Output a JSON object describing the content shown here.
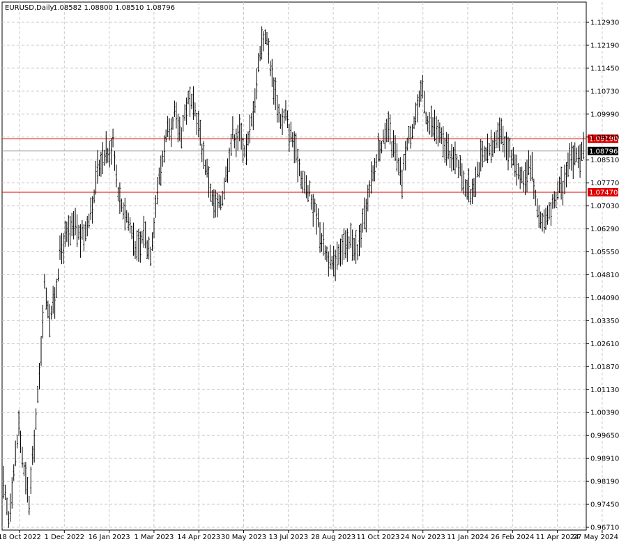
{
  "header": {
    "symbol": "EURUSD,Daily",
    "ohlc": "1.08582 1.08800 1.08510 1.08796"
  },
  "chart_data": {
    "type": "ohlc-bar",
    "title": "EURUSD,Daily",
    "ylim": [
      0.9667,
      1.133
    ],
    "y_ticks": [
      "1.12930",
      "1.12190",
      "1.11450",
      "1.10730",
      "1.09990",
      "1.09250",
      "1.08510",
      "1.07770",
      "1.07030",
      "1.06290",
      "1.05550",
      "1.04810",
      "1.04090",
      "1.03350",
      "1.02610",
      "1.01870",
      "1.01130",
      "1.00390",
      "0.99650",
      "0.98910",
      "0.98190",
      "0.97450",
      "0.96710"
    ],
    "x_ticks": [
      "18 Oct 2022",
      "1 Dec 2022",
      "16 Jan 2023",
      "1 Mar 2023",
      "14 Apr 2023",
      "30 May 2023",
      "13 Jul 2023",
      "28 Aug 2023",
      "11 Oct 2023",
      "24 Nov 2023",
      "11 Jan 2024",
      "26 Feb 2024",
      "11 Apr 2024",
      "27 May 2024"
    ],
    "horizontal_lines": [
      {
        "label": "1.09190",
        "value": 1.0919,
        "color": "#dd0000"
      },
      {
        "label": "1.07470",
        "value": 1.0747,
        "color": "#dd0000"
      },
      {
        "label": "1.08796",
        "value": 1.08796,
        "color": "#999999",
        "current": true
      }
    ],
    "path_points": [
      [
        0,
        0.98
      ],
      [
        3,
        0.97
      ],
      [
        6,
        0.985
      ],
      [
        9,
        1.0
      ],
      [
        12,
        0.985
      ],
      [
        15,
        0.975
      ],
      [
        18,
        0.995
      ],
      [
        21,
        1.015
      ],
      [
        24,
        1.045
      ],
      [
        27,
        1.035
      ],
      [
        30,
        1.04
      ],
      [
        33,
        1.055
      ],
      [
        36,
        1.06
      ],
      [
        39,
        1.062
      ],
      [
        42,
        1.064
      ],
      [
        45,
        1.06
      ],
      [
        48,
        1.062
      ],
      [
        51,
        1.07
      ],
      [
        53,
        1.072
      ],
      [
        54,
        1.08
      ],
      [
        57,
        1.085
      ],
      [
        60,
        1.089
      ],
      [
        62,
        1.086
      ],
      [
        64,
        1.093
      ],
      [
        66,
        1.08
      ],
      [
        68,
        1.072
      ],
      [
        70,
        1.07
      ],
      [
        72,
        1.067
      ],
      [
        74,
        1.064
      ],
      [
        76,
        1.06
      ],
      [
        78,
        1.056
      ],
      [
        80,
        1.057
      ],
      [
        82,
        1.063
      ],
      [
        84,
        1.058
      ],
      [
        86,
        1.056
      ],
      [
        88,
        1.065
      ],
      [
        90,
        1.076
      ],
      [
        92,
        1.082
      ],
      [
        94,
        1.09
      ],
      [
        96,
        1.094
      ],
      [
        98,
        1.092
      ],
      [
        100,
        1.1
      ],
      [
        102,
        1.096
      ],
      [
        104,
        1.094
      ],
      [
        106,
        1.1
      ],
      [
        108,
        1.104
      ],
      [
        110,
        1.102
      ],
      [
        112,
        1.101
      ],
      [
        114,
        1.096
      ],
      [
        116,
        1.089
      ],
      [
        118,
        1.084
      ],
      [
        120,
        1.079
      ],
      [
        122,
        1.072
      ],
      [
        124,
        1.07
      ],
      [
        126,
        1.07
      ],
      [
        128,
        1.074
      ],
      [
        130,
        1.08
      ],
      [
        132,
        1.087
      ],
      [
        134,
        1.094
      ],
      [
        136,
        1.092
      ],
      [
        138,
        1.094
      ],
      [
        140,
        1.09
      ],
      [
        142,
        1.088
      ],
      [
        144,
        1.094
      ],
      [
        146,
        1.101
      ],
      [
        148,
        1.11
      ],
      [
        150,
        1.121
      ],
      [
        152,
        1.124
      ],
      [
        153,
        1.126
      ],
      [
        155,
        1.12
      ],
      [
        157,
        1.112
      ],
      [
        159,
        1.106
      ],
      [
        161,
        1.1
      ],
      [
        163,
        1.097
      ],
      [
        165,
        1.1
      ],
      [
        167,
        1.094
      ],
      [
        169,
        1.092
      ],
      [
        171,
        1.087
      ],
      [
        173,
        1.083
      ],
      [
        175,
        1.078
      ],
      [
        177,
        1.076
      ],
      [
        179,
        1.074
      ],
      [
        181,
        1.07
      ],
      [
        183,
        1.068
      ],
      [
        185,
        1.062
      ],
      [
        187,
        1.058
      ],
      [
        189,
        1.055
      ],
      [
        191,
        1.052
      ],
      [
        193,
        1.051
      ],
      [
        195,
        1.055
      ],
      [
        197,
        1.057
      ],
      [
        199,
        1.058
      ],
      [
        201,
        1.056
      ],
      [
        203,
        1.06
      ],
      [
        205,
        1.058
      ],
      [
        207,
        1.055
      ],
      [
        209,
        1.062
      ],
      [
        211,
        1.066
      ],
      [
        213,
        1.072
      ],
      [
        215,
        1.078
      ],
      [
        217,
        1.082
      ],
      [
        219,
        1.089
      ],
      [
        221,
        1.091
      ],
      [
        223,
        1.091
      ],
      [
        225,
        1.096
      ],
      [
        227,
        1.09
      ],
      [
        229,
        1.088
      ],
      [
        231,
        1.082
      ],
      [
        233,
        1.078
      ],
      [
        235,
        1.088
      ],
      [
        237,
        1.092
      ],
      [
        239,
        1.096
      ],
      [
        241,
        1.1
      ],
      [
        243,
        1.103
      ],
      [
        245,
        1.108
      ],
      [
        247,
        1.1
      ],
      [
        249,
        1.097
      ],
      [
        251,
        1.096
      ],
      [
        253,
        1.095
      ],
      [
        255,
        1.093
      ],
      [
        257,
        1.09
      ],
      [
        259,
        1.088
      ],
      [
        261,
        1.087
      ],
      [
        263,
        1.084
      ],
      [
        265,
        1.086
      ],
      [
        267,
        1.082
      ],
      [
        269,
        1.079
      ],
      [
        271,
        1.076
      ],
      [
        273,
        1.074
      ],
      [
        275,
        1.078
      ],
      [
        277,
        1.082
      ],
      [
        279,
        1.085
      ],
      [
        281,
        1.086
      ],
      [
        283,
        1.087
      ],
      [
        285,
        1.088
      ],
      [
        287,
        1.09
      ],
      [
        289,
        1.095
      ],
      [
        291,
        1.094
      ],
      [
        293,
        1.091
      ],
      [
        295,
        1.089
      ],
      [
        297,
        1.086
      ],
      [
        299,
        1.084
      ],
      [
        301,
        1.082
      ],
      [
        303,
        1.08
      ],
      [
        305,
        1.078
      ],
      [
        307,
        1.085
      ],
      [
        309,
        1.083
      ],
      [
        311,
        1.072
      ],
      [
        313,
        1.068
      ],
      [
        315,
        1.065
      ],
      [
        317,
        1.066
      ],
      [
        319,
        1.069
      ],
      [
        321,
        1.07
      ],
      [
        323,
        1.072
      ],
      [
        325,
        1.078
      ],
      [
        327,
        1.076
      ],
      [
        329,
        1.082
      ],
      [
        331,
        1.088
      ],
      [
        333,
        1.085
      ],
      [
        335,
        1.087
      ],
      [
        337,
        1.086
      ],
      [
        339,
        1.0878
      ]
    ]
  }
}
